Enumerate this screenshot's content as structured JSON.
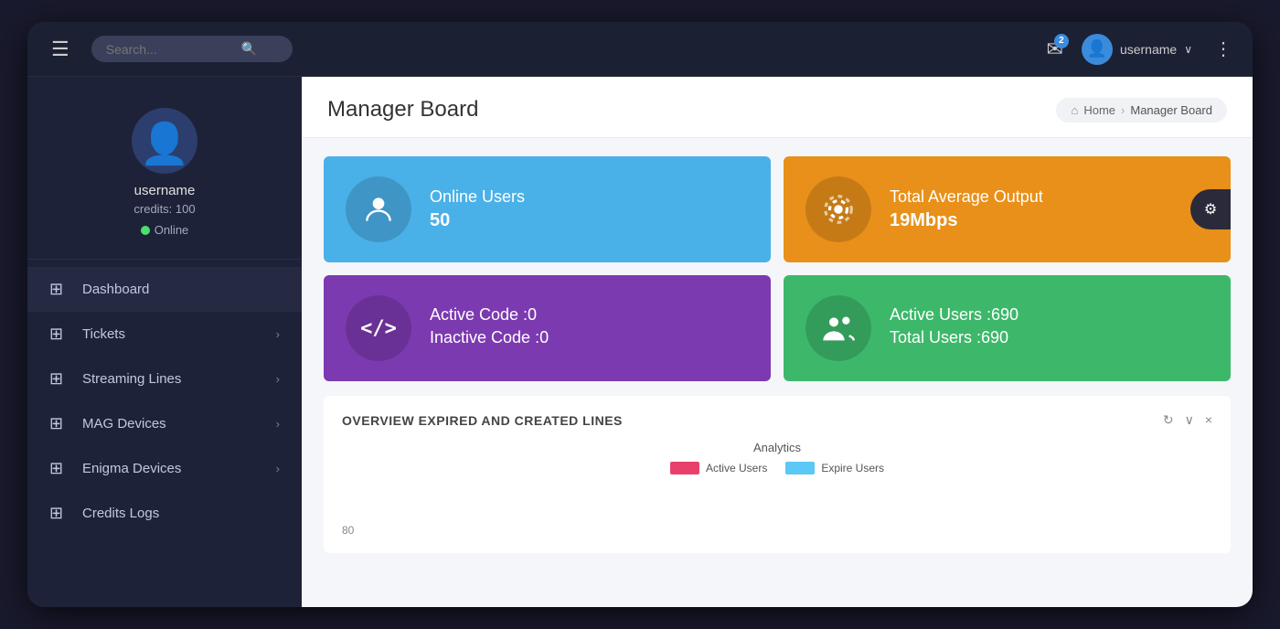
{
  "topbar": {
    "search_placeholder": "Search...",
    "notification_count": "2",
    "username": "username",
    "dots": "⋮"
  },
  "sidebar": {
    "profile": {
      "username": "username",
      "credits": "credits: 100",
      "status": "Online"
    },
    "nav_items": [
      {
        "id": "dashboard",
        "label": "Dashboard",
        "icon": "⊞",
        "has_chevron": false,
        "active": true
      },
      {
        "id": "tickets",
        "label": "Tickets",
        "icon": "⊞",
        "has_chevron": true,
        "active": false
      },
      {
        "id": "streaming-lines",
        "label": "Streaming Lines",
        "icon": "⊞",
        "has_chevron": true,
        "active": false
      },
      {
        "id": "mag-devices",
        "label": "MAG Devices",
        "icon": "⊞",
        "has_chevron": true,
        "active": false
      },
      {
        "id": "enigma-devices",
        "label": "Enigma Devices",
        "icon": "⊞",
        "has_chevron": true,
        "active": false
      },
      {
        "id": "credits-logs",
        "label": "Credits Logs",
        "icon": "⊞",
        "has_chevron": false,
        "active": false
      }
    ]
  },
  "content": {
    "page_title": "Manager Board",
    "breadcrumb": {
      "home": "Home",
      "current": "Manager Board"
    },
    "stats": [
      {
        "id": "online-users",
        "color": "blue",
        "icon": "👤",
        "icon_unicode": "person",
        "label": "Online Users",
        "value": "50"
      },
      {
        "id": "total-avg-output",
        "color": "orange",
        "icon": "⚙",
        "icon_unicode": "settings",
        "label": "Total Average Output",
        "value": "19Mbps",
        "has_gear": true
      },
      {
        "id": "active-inactive-code",
        "color": "purple",
        "icon": "</>",
        "icon_unicode": "code",
        "label_line1": "Active Code :0",
        "label_line2": "Inactive Code :0"
      },
      {
        "id": "active-total-users",
        "color": "green",
        "icon": "👥",
        "icon_unicode": "group",
        "label_line1": "Active Users :690",
        "label_line2": "Total Users :690"
      }
    ],
    "overview": {
      "title": "OVERVIEW EXPIRED AND CREATED LINES",
      "actions": [
        "↻",
        "∨",
        "×"
      ],
      "chart_title": "Analytics",
      "legend": [
        {
          "label": "Active Users",
          "color": "pink"
        },
        {
          "label": "Expire Users",
          "color": "light-blue"
        }
      ],
      "chart_label": "80"
    }
  }
}
